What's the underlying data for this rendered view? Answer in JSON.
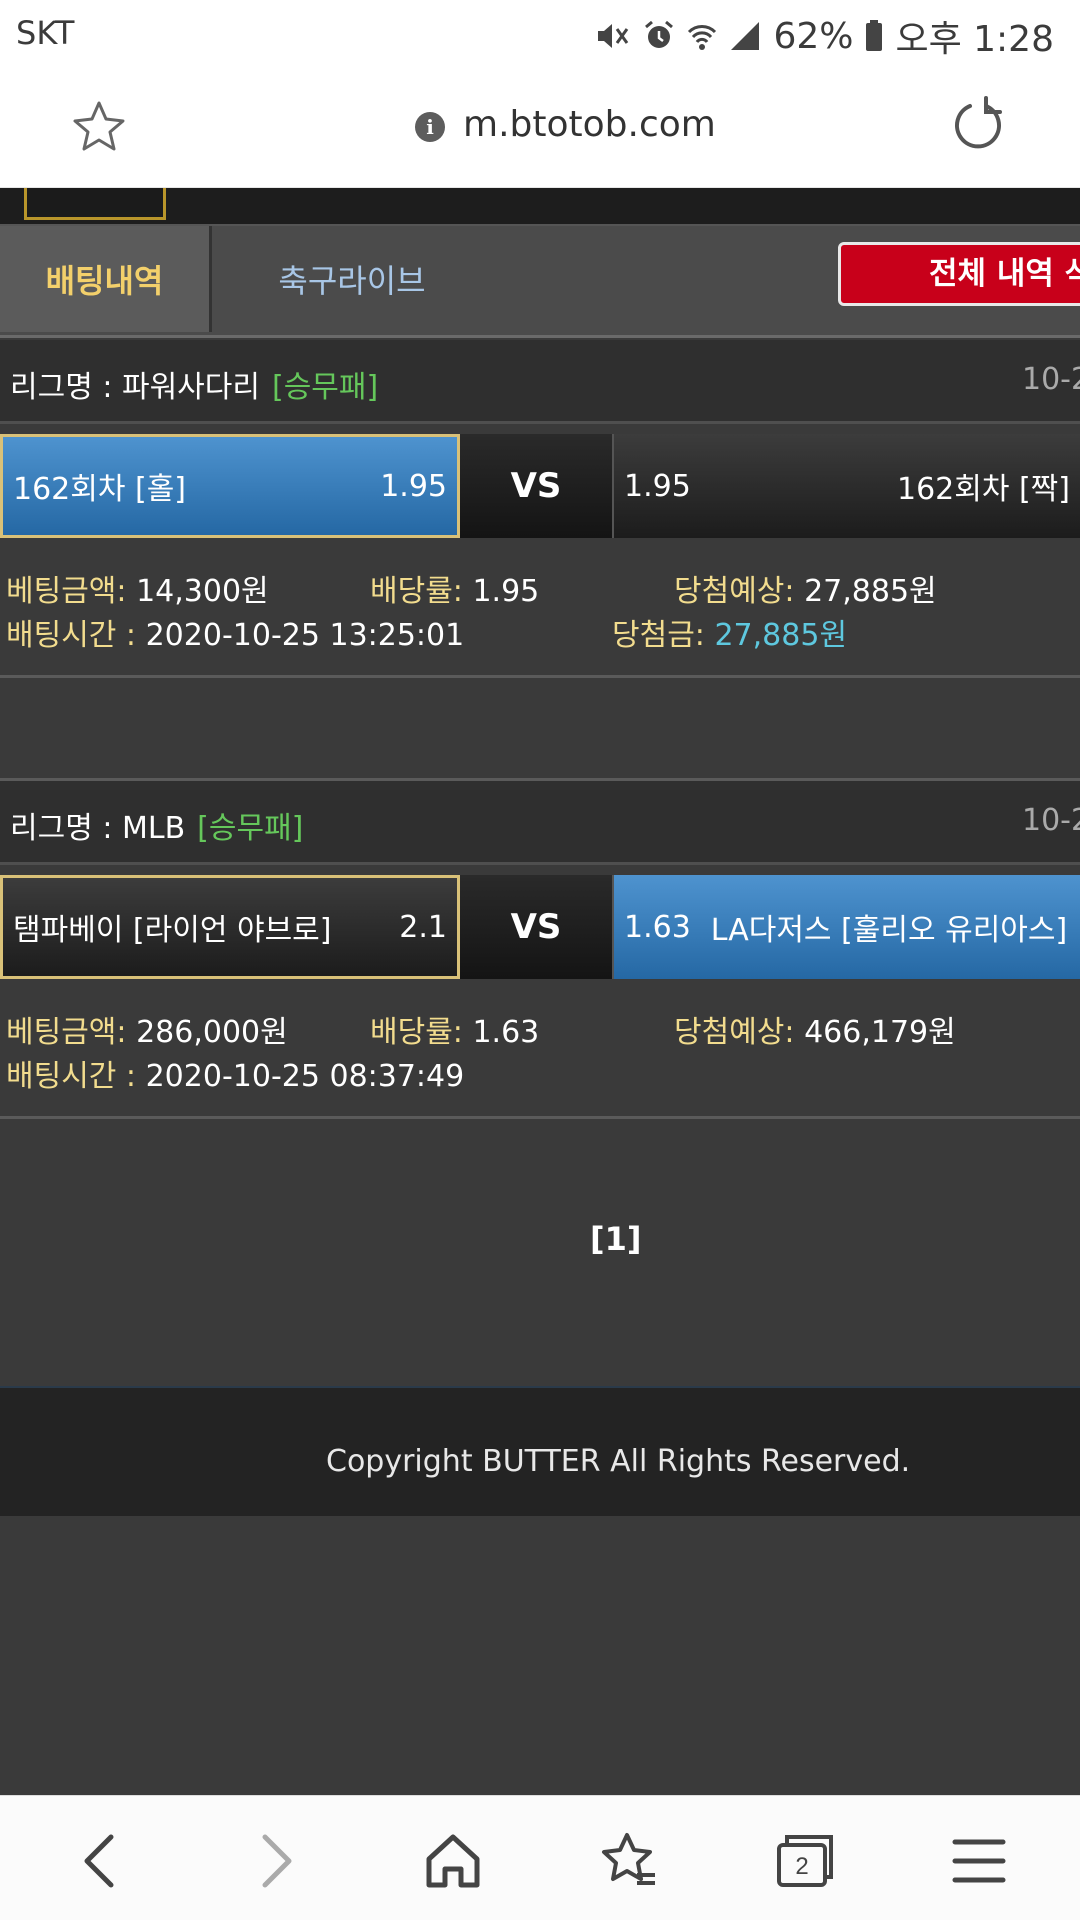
{
  "status_bar": {
    "carrier": "SKT",
    "battery": "62%",
    "time": "오후 1:28"
  },
  "url_bar": {
    "url": "m.btotob.com"
  },
  "tabs": [
    {
      "label": "배팅내역",
      "active": true
    },
    {
      "label": "축구라이브",
      "active": false
    }
  ],
  "delete_all_button": "전체 내역 삭",
  "bets": [
    {
      "league_label": "리그명 : 파워사다리",
      "bet_type": "[승무패]",
      "date_partial": "10-2",
      "home_team": "162회차 [홀]",
      "home_odds": "1.95",
      "vs": "VS",
      "away_odds": "1.95",
      "away_team": "162회차 [짝]",
      "selected": "home",
      "amount_label": "베팅금액:",
      "amount": "14,300원",
      "rate_label": "배당률:",
      "rate": "1.95",
      "expected_label": "당첨예상:",
      "expected": "27,885원",
      "time_label": "배팅시간 :",
      "time": "2020-10-25 13:25:01",
      "win_label": "당첨금:",
      "win": "27,885원"
    },
    {
      "league_label": "리그명 : MLB",
      "bet_type": "[승무패]",
      "date_partial": "10-2",
      "home_team": "탬파베이 [라이언 야브로]",
      "home_odds": "2.1",
      "vs": "VS",
      "away_odds": "1.63",
      "away_team": "LA다저스 [훌리오 유리아스]",
      "selected": "away",
      "amount_label": "베팅금액:",
      "amount": "286,000원",
      "rate_label": "배당률:",
      "rate": "1.63",
      "expected_label": "당첨예상:",
      "expected": "466,179원",
      "time_label": "배팅시간 :",
      "time": "2020-10-25 08:37:49"
    }
  ],
  "pagination": "[1]",
  "footer": {
    "copyright": "Copyright BUTTER All Rights Reserved."
  },
  "bottom_nav": {
    "tabs_count": "2"
  },
  "colors": {
    "selected_blue": "#3a80bf",
    "gold_label": "#f2dc8e",
    "tab_active": "#f3d06b",
    "button_red": "#c8001a",
    "win_cyan": "#5ec8df"
  }
}
